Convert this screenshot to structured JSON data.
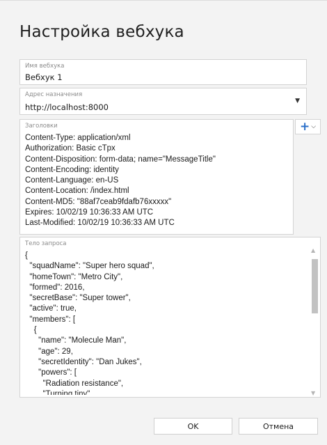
{
  "dialog": {
    "title": "Настройка вебхука"
  },
  "name_field": {
    "label": "Имя вебхука",
    "value": "Вебхук 1"
  },
  "url_field": {
    "label": "Адрес назначения",
    "value": "http://localhost:8000"
  },
  "headers_field": {
    "label": "Заголовки",
    "lines": [
      "Content-Type: application/xml",
      "Authorization: Basic cTpx",
      "Content-Disposition: form-data; name=\"MessageTitle\"",
      "Content-Encoding: identity",
      "Content-Language: en-US",
      "Content-Location: /index.html",
      "Content-MD5: \"88af7ceab9fdafb76xxxxx\"",
      "Expires: 10/02/19 10:36:33 AM UTC",
      "Last-Modified: 10/02/19 10:36:33 AM UTC"
    ]
  },
  "body_field": {
    "label": "Тело запроса",
    "lines": [
      "{",
      "  \"squadName\": \"Super hero squad\",",
      "  \"homeTown\": \"Metro City\",",
      "  \"formed\": 2016,",
      "  \"secretBase\": \"Super tower\",",
      "  \"active\": true,",
      "  \"members\": [",
      "    {",
      "      \"name\": \"Molecule Man\",",
      "      \"age\": 29,",
      "      \"secretIdentity\": \"Dan Jukes\",",
      "      \"powers\": [",
      "        \"Radiation resistance\",",
      "        \"Turning tiny\","
    ]
  },
  "buttons": {
    "ok": "OK",
    "cancel": "Отмена"
  },
  "icons": {
    "add": "plus-icon",
    "dropdown": "chevron-down-icon"
  },
  "colors": {
    "accent": "#2a6fc9"
  }
}
